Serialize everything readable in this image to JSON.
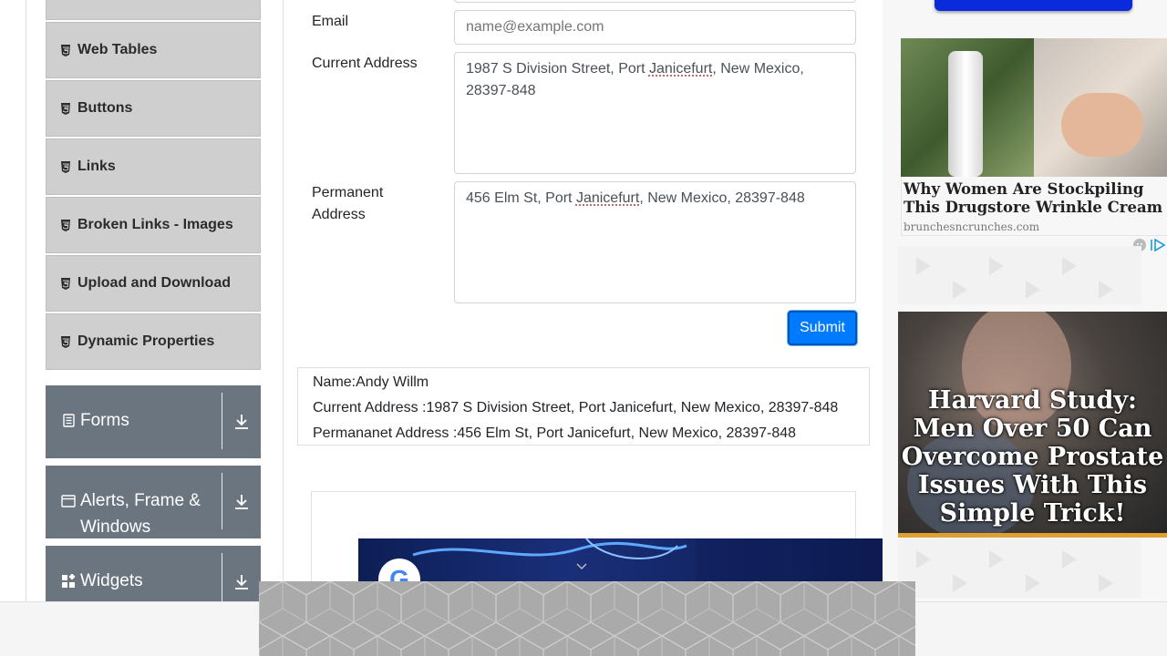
{
  "sidebar": {
    "elements_items": [
      {
        "label": "Web Tables"
      },
      {
        "label": "Buttons"
      },
      {
        "label": "Links"
      },
      {
        "label": "Broken Links - Images"
      },
      {
        "label": "Upload and Download"
      },
      {
        "label": "Dynamic Properties"
      }
    ],
    "groups": [
      {
        "label": "Forms",
        "icon": "form-icon"
      },
      {
        "label": "Alerts, Frame & Windows",
        "icon": "window-icon"
      },
      {
        "label": "Widgets",
        "icon": "widgets-icon"
      }
    ]
  },
  "form": {
    "email_label": "Email",
    "email_placeholder": "name@example.com",
    "current_address_label": "Current Address",
    "current_address_value_pre": "1987 S Division Street, Port ",
    "current_address_value_mark": "Janicefurt",
    "current_address_value_post": ", New Mexico, 28397-848",
    "permanent_address_label_line1": "Permanent",
    "permanent_address_label_line2": "Address",
    "permanent_address_value_pre": "456 Elm St, Port ",
    "permanent_address_value_mark": "Janicefurt",
    "permanent_address_value_post": ", New Mexico, 28397-848",
    "submit_label": "Submit"
  },
  "output": {
    "name": "Name:Andy Willm",
    "current_address": "Current Address :1987 S Division Street, Port Janicefurt, New Mexico, 28397-848",
    "permanent_address": "Permananet Address :456 Elm St, Port Janicefurt, New Mexico, 28397-848"
  },
  "ads": {
    "ad1_title": "Why Women Are Stockpiling This Drugstore Wrinkle Cream",
    "ad1_source": "brunchesncrunches.com",
    "ad2_text": "Harvard Study: Men Over 50 Can Overcome Prostate Issues With This Simple Trick!",
    "video_logo": "G"
  },
  "colors": {
    "accent": "#007bff",
    "group_bg": "#6b7580",
    "menu_bg": "#cfcfcf"
  }
}
